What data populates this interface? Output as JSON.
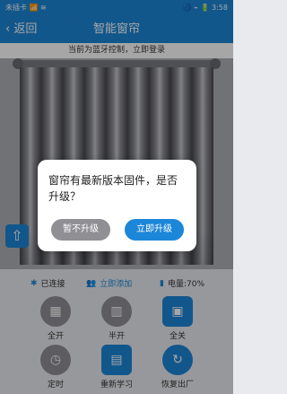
{
  "status_bar": {
    "left": "未插卡 📶 ≋",
    "right": "🔵 ⌁ 🔋 3:58"
  },
  "header": {
    "back": "返回",
    "title": "智能窗帘"
  },
  "notice": "当前为蓝牙控制，立即登录",
  "dialog": {
    "message": "窗帘有最新版本固件，是否升级？",
    "cancel": "暂不升级",
    "ok": "立即升级"
  },
  "status_row": {
    "connected": "已连接",
    "add": "立即添加",
    "battery": "电量:70%"
  },
  "controls": [
    {
      "label": "全开"
    },
    {
      "label": "半开"
    },
    {
      "label": "全关"
    },
    {
      "label": "定时"
    },
    {
      "label": "重新学习"
    },
    {
      "label": "恢复出厂"
    }
  ],
  "colors": {
    "primary": "#1c86d8",
    "grey": "#8f9095"
  },
  "icons": {
    "bluetooth": "bluetooth-icon",
    "add_user": "add-user-icon",
    "battery": "battery-icon"
  }
}
